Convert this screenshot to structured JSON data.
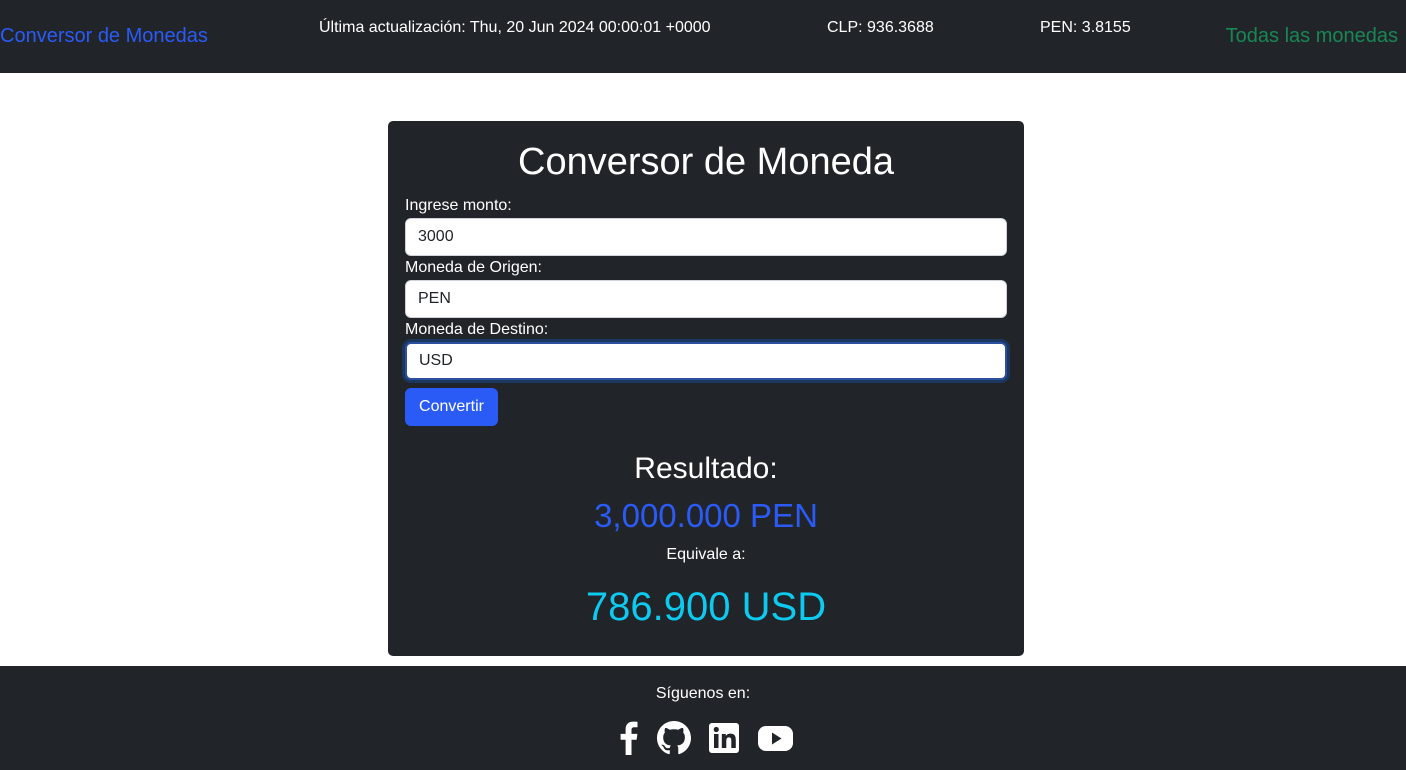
{
  "navbar": {
    "brand": "Conversor de Monedas",
    "last_update": "Última actualización: Thu, 20 Jun 2024 00:00:01 +0000",
    "clp_rate": "CLP: 936.3688",
    "pen_rate": "PEN: 3.8155",
    "all_currencies_link": "Todas las monedas",
    "colors": {
      "brand": "#2a5bf6",
      "all_link": "#198754",
      "background": "#212529"
    }
  },
  "converter": {
    "title": "Conversor de Moneda",
    "amount_label": "Ingrese monto:",
    "amount_value": "3000",
    "origin_label": "Moneda de Origen:",
    "origin_value": "PEN",
    "destination_label": "Moneda de Destino:",
    "destination_value": "USD",
    "convert_button": "Convertir"
  },
  "result": {
    "heading": "Resultado:",
    "source_amount": "3,000.000 PEN",
    "equivalent_label": "Equivale a:",
    "target_amount": "786.900 USD",
    "colors": {
      "source": "#2a5bf6",
      "target": "#0dcaf0"
    }
  },
  "footer": {
    "follow_text": "Síguenos en:",
    "social_icons": [
      "facebook-icon",
      "github-icon",
      "linkedin-icon",
      "youtube-icon"
    ],
    "copyright": ""
  }
}
